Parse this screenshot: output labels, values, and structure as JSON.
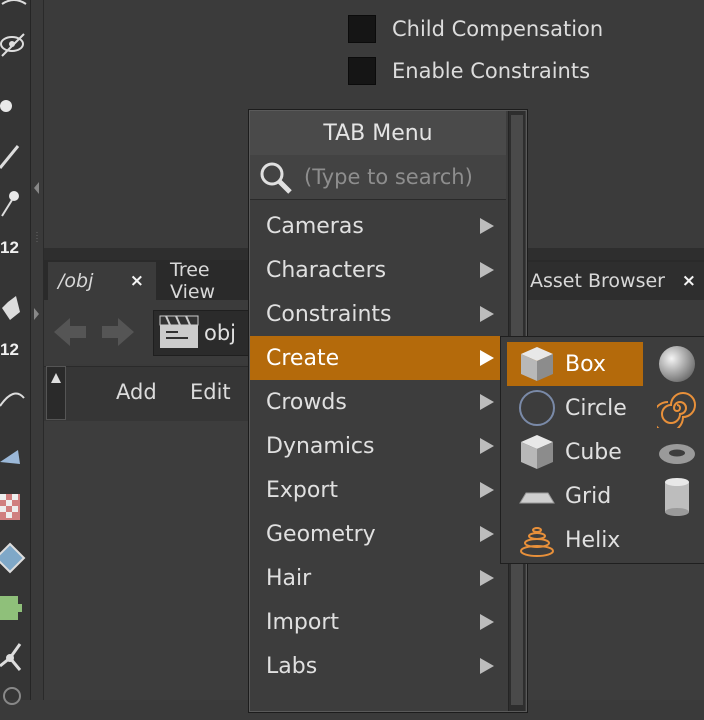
{
  "parameters": {
    "checkboxes": [
      {
        "label": "Child Compensation",
        "checked": false
      },
      {
        "label": "Enable Constraints",
        "checked": false
      }
    ]
  },
  "left_toolbar": {
    "numbers": [
      "12",
      "12"
    ]
  },
  "pane_tabs": [
    {
      "label": "/obj",
      "close": "×"
    },
    {
      "label": "Tree View"
    },
    {
      "label": "Asset Browser",
      "close": "×"
    }
  ],
  "path": {
    "value": "obj"
  },
  "network_menubar": [
    "Add",
    "Edit"
  ],
  "tab_menu": {
    "title": "TAB Menu",
    "search_placeholder": "(Type to search)",
    "items": [
      {
        "label": "Cameras"
      },
      {
        "label": "Characters"
      },
      {
        "label": "Constraints"
      },
      {
        "label": "Create",
        "active": true
      },
      {
        "label": "Crowds"
      },
      {
        "label": "Dynamics"
      },
      {
        "label": "Export"
      },
      {
        "label": "Geometry"
      },
      {
        "label": "Hair"
      },
      {
        "label": "Import"
      },
      {
        "label": "Labs"
      }
    ]
  },
  "create_submenu": {
    "items": [
      {
        "label": "Box",
        "icon": "box-icon",
        "active": true
      },
      {
        "label": "Circle",
        "icon": "circle-icon"
      },
      {
        "label": "Cube",
        "icon": "cube-icon"
      },
      {
        "label": "Grid",
        "icon": "grid-icon"
      },
      {
        "label": "Helix",
        "icon": "helix-icon"
      }
    ],
    "second_column_icons": [
      "sphere-icon",
      "spiral-icon",
      "torus-icon",
      "tube-icon"
    ]
  },
  "colors": {
    "accent": "#b46a0b",
    "menu_bg": "#3d3d3d",
    "panel_bg": "#3b3b3b"
  }
}
